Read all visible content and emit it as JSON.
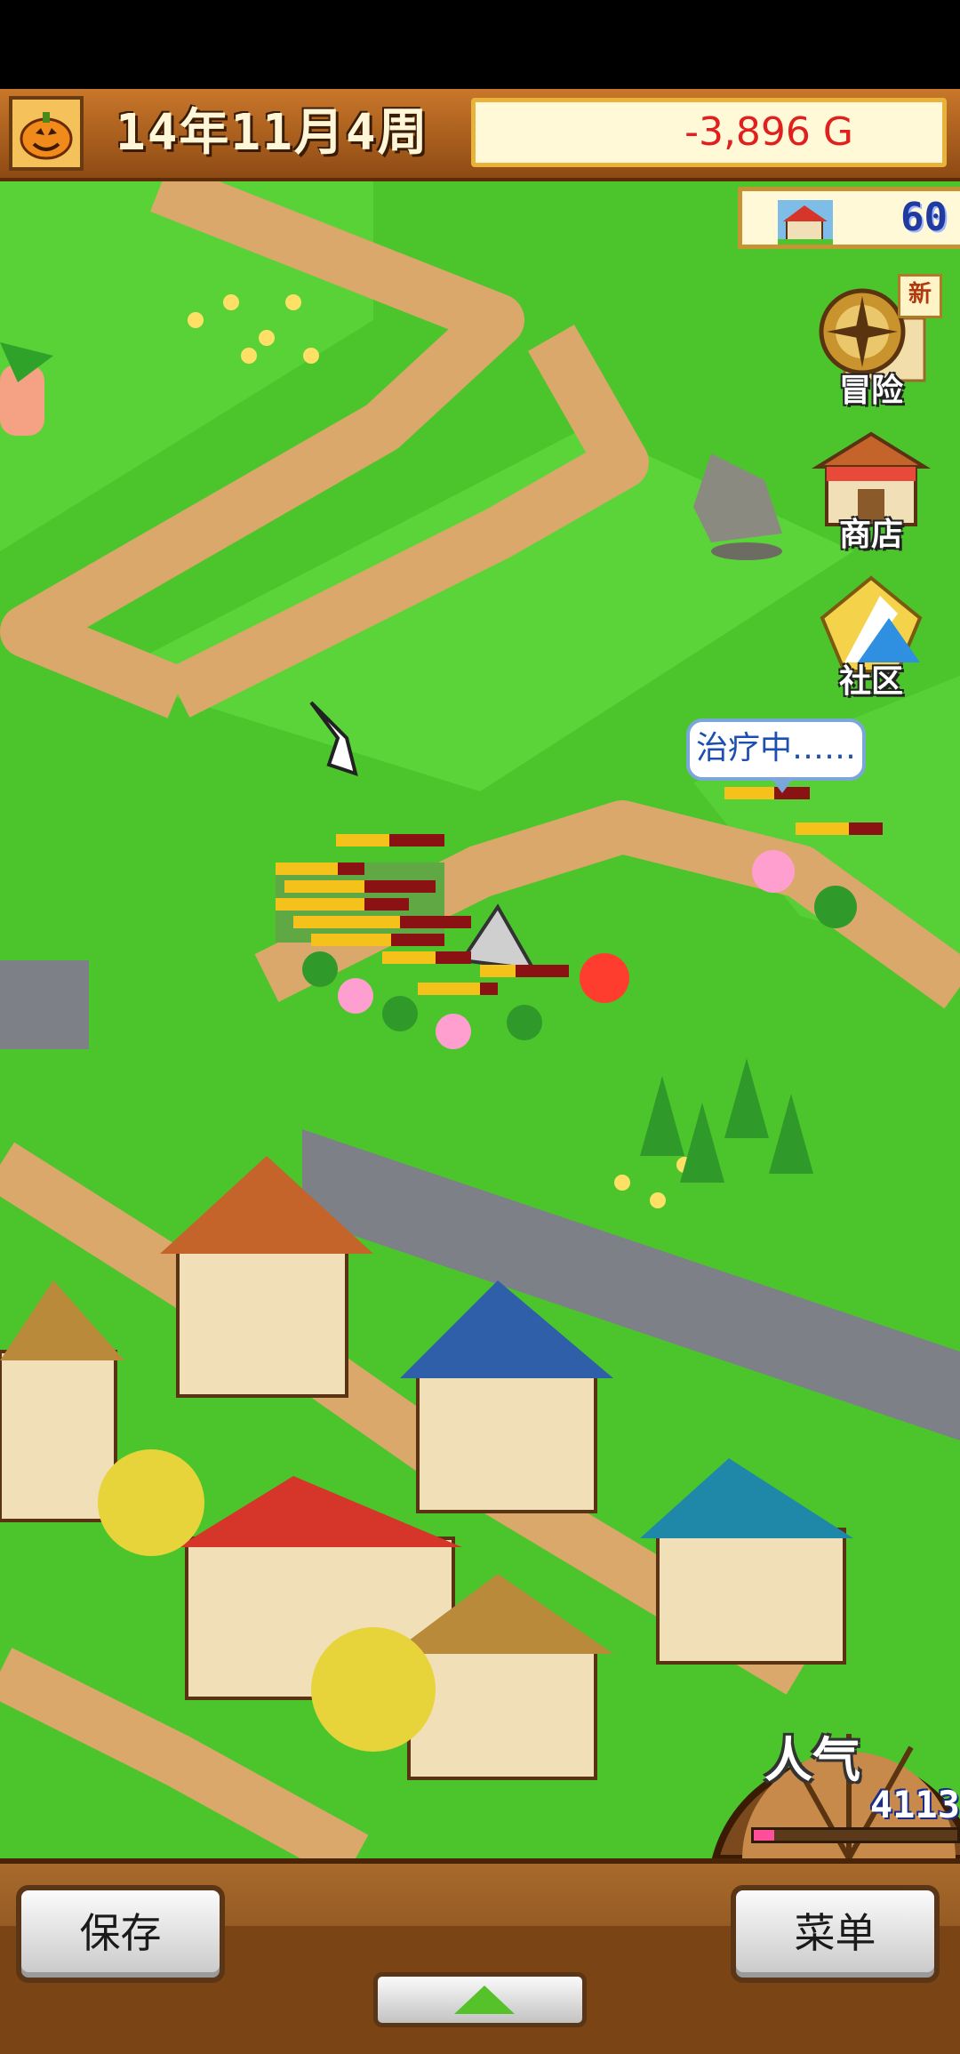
{
  "hud": {
    "date": "14年11月4周",
    "money": "-3,896 G",
    "town_count": "60"
  },
  "side_menu": {
    "adventure_label": "冒险",
    "adventure_badge": "新",
    "shop_label": "商店",
    "community_label": "社区"
  },
  "speech_bubble": "治疗中……",
  "popularity": {
    "label": "人气",
    "value": "4113",
    "level": 0.1
  },
  "bottom_bar": {
    "save_label": "保存",
    "menu_label": "菜单"
  },
  "colors": {
    "grass": "#4cc52c",
    "path": "#d9a86a",
    "money_red": "#e0201e",
    "hud_wood": "#8e4a14"
  }
}
